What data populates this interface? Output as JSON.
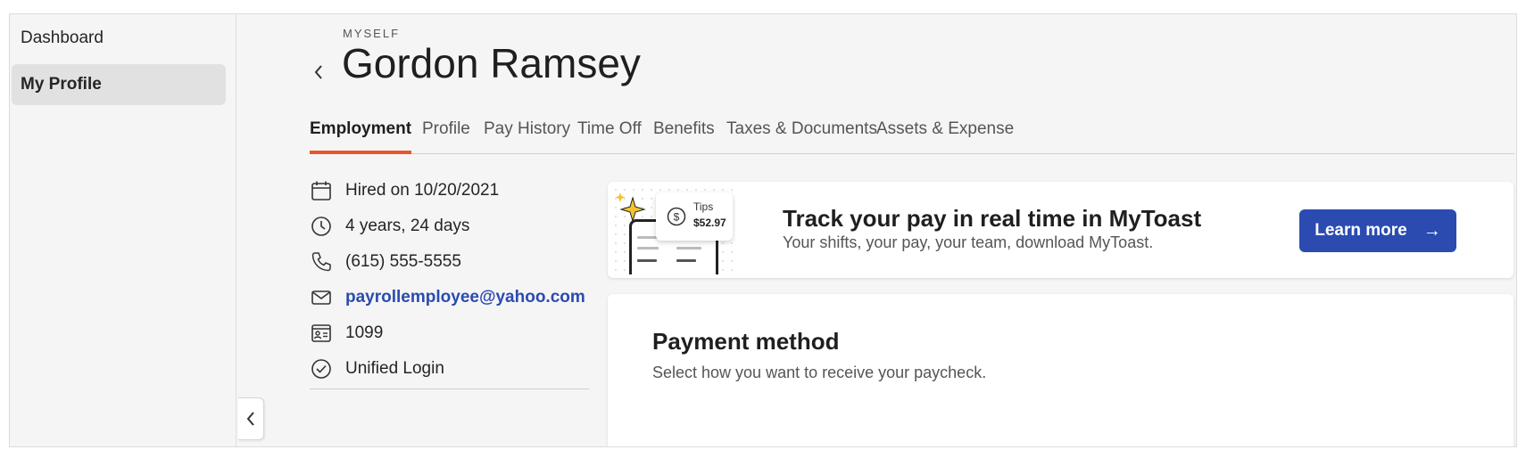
{
  "sidebar": {
    "items": [
      {
        "label": "Dashboard"
      },
      {
        "label": "My Profile",
        "active": true
      }
    ]
  },
  "header": {
    "eyebrow": "MYSELF",
    "title": "Gordon Ramsey"
  },
  "tabs": [
    {
      "label": "Employment",
      "active": true
    },
    {
      "label": "Profile"
    },
    {
      "label": "Pay History"
    },
    {
      "label": "Time Off"
    },
    {
      "label": "Benefits"
    },
    {
      "label": "Taxes & Documents"
    },
    {
      "label": "Assets & Expense"
    }
  ],
  "details": {
    "hired": "Hired on 10/20/2021",
    "tenure": "4 years, 24 days",
    "phone": "(615) 555-5555",
    "email": "payrollemployee@yahoo.com",
    "worker_type": "1099",
    "login": "Unified Login",
    "icons": [
      "calendar-icon",
      "clock-icon",
      "phone-icon",
      "mail-icon",
      "id-card-icon",
      "check-circle-icon"
    ]
  },
  "promo": {
    "tips_label": "Tips",
    "tips_amount": "$52.97",
    "title": "Track your pay in real time in MyToast",
    "subtitle": "Your shifts, your pay, your team, download MyToast.",
    "button_label": "Learn more",
    "button_arrow": "→"
  },
  "payment": {
    "title": "Payment method",
    "subtitle": "Select how you want to receive your paycheck."
  },
  "colors": {
    "accent": "#e8552b",
    "primary": "#2b4bb0",
    "background": "#f5f5f5"
  }
}
